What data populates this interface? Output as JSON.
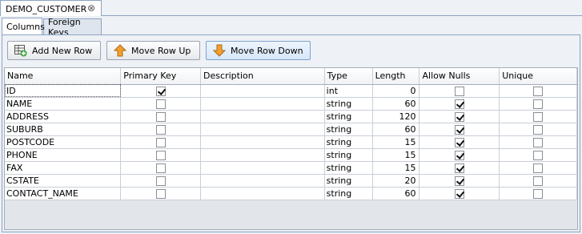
{
  "document_tab": {
    "title": "DEMO_CUSTOMER",
    "close": "⊗"
  },
  "sub_tabs": [
    {
      "label": "Columns"
    },
    {
      "label": "Foreign Keys"
    }
  ],
  "toolbar": {
    "add_label": "Add New Row",
    "up_label": "Move Row Up",
    "down_label": "Move Row Down"
  },
  "table": {
    "headers": [
      "Name",
      "Primary Key",
      "Description",
      "Type",
      "Length",
      "Allow Nulls",
      "Unique"
    ],
    "rows": [
      {
        "name": "ID",
        "primary_key": true,
        "description": "",
        "type": "int",
        "length": "0",
        "allow_nulls": false,
        "unique": false
      },
      {
        "name": "NAME",
        "primary_key": false,
        "description": "",
        "type": "string",
        "length": "60",
        "allow_nulls": true,
        "unique": false
      },
      {
        "name": "ADDRESS",
        "primary_key": false,
        "description": "",
        "type": "string",
        "length": "120",
        "allow_nulls": true,
        "unique": false
      },
      {
        "name": "SUBURB",
        "primary_key": false,
        "description": "",
        "type": "string",
        "length": "60",
        "allow_nulls": true,
        "unique": false
      },
      {
        "name": "POSTCODE",
        "primary_key": false,
        "description": "",
        "type": "string",
        "length": "15",
        "allow_nulls": true,
        "unique": false
      },
      {
        "name": "PHONE",
        "primary_key": false,
        "description": "",
        "type": "string",
        "length": "15",
        "allow_nulls": true,
        "unique": false
      },
      {
        "name": "FAX",
        "primary_key": false,
        "description": "",
        "type": "string",
        "length": "15",
        "allow_nulls": true,
        "unique": false
      },
      {
        "name": "CSTATE",
        "primary_key": false,
        "description": "",
        "type": "string",
        "length": "20",
        "allow_nulls": true,
        "unique": false
      },
      {
        "name": "CONTACT_NAME",
        "primary_key": false,
        "description": "",
        "type": "string",
        "length": "60",
        "allow_nulls": true,
        "unique": false
      }
    ]
  },
  "colors": {
    "accent_border": "#8ea4c1",
    "arrow_orange": "#f0a030",
    "add_green": "#3aa63a"
  }
}
